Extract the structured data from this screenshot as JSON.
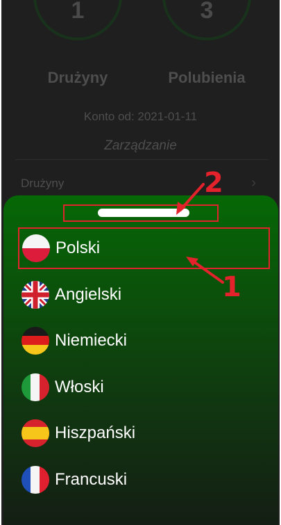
{
  "profile": {
    "stats": [
      {
        "value": "1",
        "label": "Drużyny"
      },
      {
        "value": "3",
        "label": "Polubienia"
      }
    ],
    "account_since": "Konto od: 2021-01-11",
    "section_title": "Zarządzanie",
    "menu_items": [
      {
        "label": "Drużyny",
        "icon": "chevron-right-icon"
      }
    ]
  },
  "language_sheet": {
    "handle_icon": "drag-handle",
    "languages": [
      {
        "label": "Polski",
        "flag": "poland-flag-icon",
        "selected": true
      },
      {
        "label": "Angielski",
        "flag": "uk-flag-icon",
        "selected": false
      },
      {
        "label": "Niemiecki",
        "flag": "germany-flag-icon",
        "selected": false
      },
      {
        "label": "Włoski",
        "flag": "italy-flag-icon",
        "selected": false
      },
      {
        "label": "Hiszpański",
        "flag": "spain-flag-icon",
        "selected": false
      },
      {
        "label": "Francuski",
        "flag": "france-flag-icon",
        "selected": false
      }
    ]
  },
  "annotations": {
    "marker_1": "1",
    "marker_2": "2",
    "color": "#e3222c"
  },
  "colors": {
    "sheet_top": "#066806",
    "sheet_bottom": "#141d14",
    "background": "#1f1f1f"
  }
}
